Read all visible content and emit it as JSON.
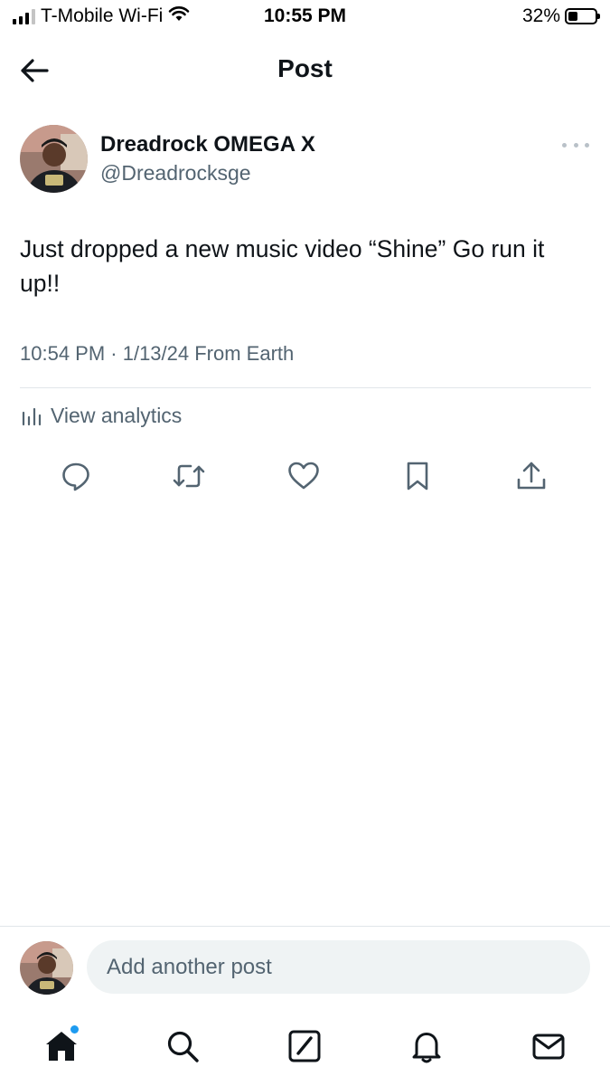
{
  "status_bar": {
    "carrier": "T-Mobile Wi-Fi",
    "time": "10:55 PM",
    "battery": "32%",
    "battery_level": 0.32
  },
  "header": {
    "title": "Post",
    "back_icon": "arrow-left-icon"
  },
  "post": {
    "author_name": "Dreadrock OMEGA X",
    "author_handle": "@Dreadrocksge",
    "text": "Just dropped a new music video “Shine” Go run it up!!",
    "meta": "10:54 PM · 1/13/24 From Earth",
    "analytics_label": "View analytics",
    "actions": [
      "reply-icon",
      "repost-icon",
      "like-icon",
      "bookmark-icon",
      "share-icon"
    ]
  },
  "reply": {
    "placeholder": "Add another post"
  },
  "nav": {
    "items": [
      "home-icon",
      "search-icon",
      "compose-icon",
      "notifications-icon",
      "messages-icon"
    ],
    "home_has_notification": true
  },
  "colors": {
    "text": "#0f1419",
    "secondary": "#536471",
    "accent": "#1d9bf0",
    "input_bg": "#eff3f4"
  }
}
